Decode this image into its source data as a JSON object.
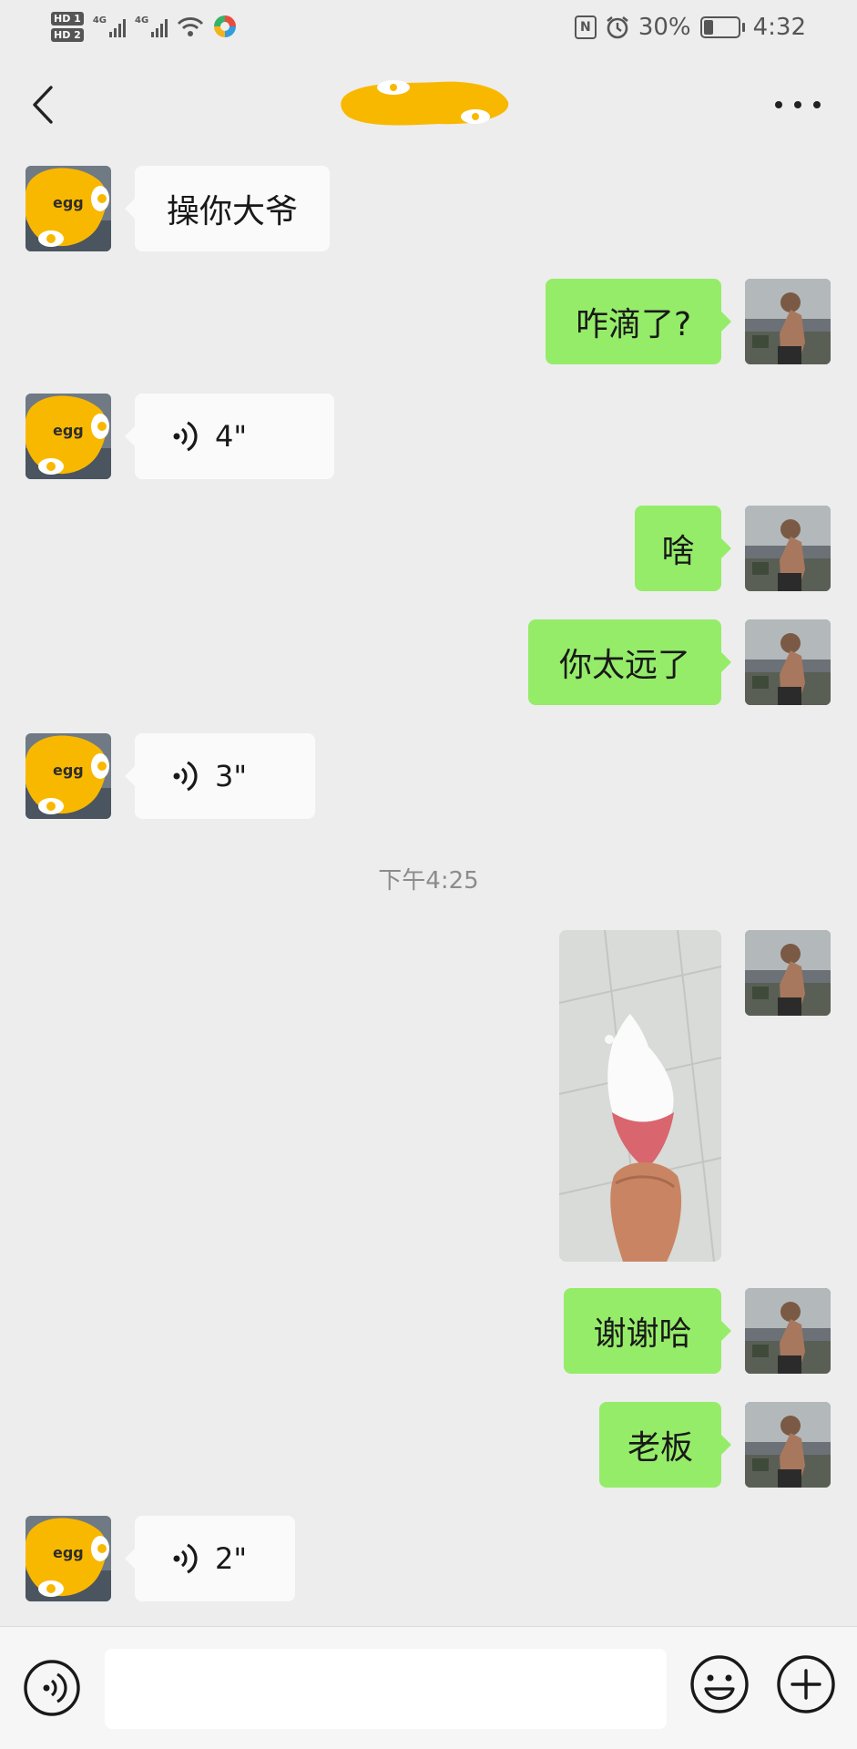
{
  "status_bar": {
    "sim1_label": "HD 1",
    "sim2_label": "HD 2",
    "network1": "4G",
    "network2": "4G",
    "nfc": "N",
    "battery_percent": "30%",
    "battery_level": 0.3,
    "time": "4:32"
  },
  "header": {
    "back_icon": "chevron-left-icon",
    "title_redacted": true,
    "more_icon": "more-dots-icon"
  },
  "messages": [
    {
      "from": "other",
      "type": "text",
      "text": "操你大爷"
    },
    {
      "from": "me",
      "type": "text",
      "text": "咋滴了?"
    },
    {
      "from": "other",
      "type": "voice",
      "duration": "4\""
    },
    {
      "from": "me",
      "type": "text",
      "text": "啥"
    },
    {
      "from": "me",
      "type": "text",
      "text": "你太远了"
    },
    {
      "from": "other",
      "type": "voice",
      "duration": "3\""
    },
    {
      "type": "timestamp",
      "text": "下午4:25"
    },
    {
      "from": "me",
      "type": "image",
      "subject": "ice cream cone photo"
    },
    {
      "from": "me",
      "type": "text",
      "text": "谢谢哈"
    },
    {
      "from": "me",
      "type": "text",
      "text": "老板"
    },
    {
      "from": "other",
      "type": "voice",
      "duration": "2\""
    }
  ],
  "input_bar": {
    "voice_icon": "voice-mode-icon",
    "input_value": "",
    "emoji_icon": "emoji-icon",
    "plus_icon": "plus-icon"
  },
  "colors": {
    "background": "#ededed",
    "outgoing_bubble": "#95ec69",
    "incoming_bubble": "#fafafa",
    "redaction": "#f9b800"
  }
}
